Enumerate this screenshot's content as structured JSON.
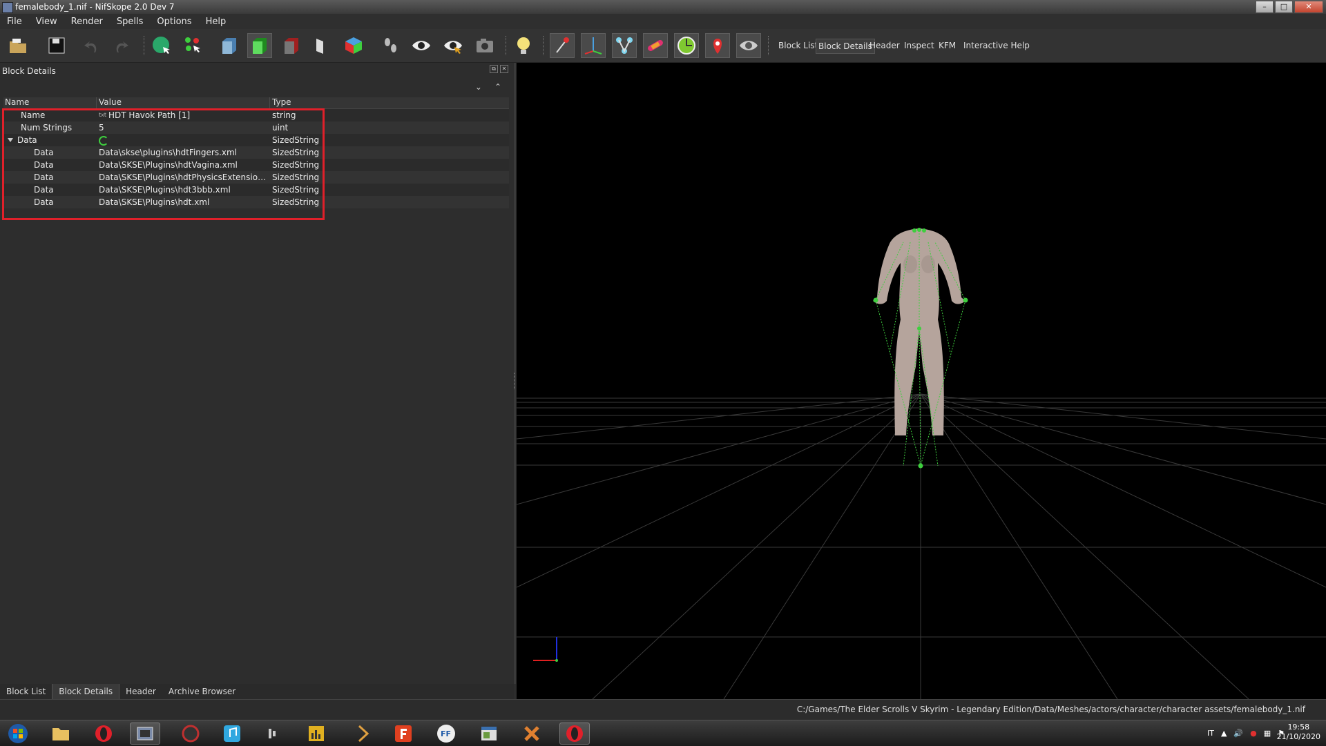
{
  "window": {
    "title": "femalebody_1.nif - NifSkope 2.0 Dev 7",
    "buttons": [
      "–",
      "□",
      "✕"
    ]
  },
  "menu": [
    "File",
    "View",
    "Render",
    "Spells",
    "Options",
    "Help"
  ],
  "toolbar": {
    "text_buttons": [
      "Block List",
      "Block Details",
      "Header",
      "Inspect",
      "KFM",
      "Interactive Help"
    ],
    "active_text_button": "Block Details"
  },
  "dock": {
    "title": "Block Details",
    "columns": {
      "name": "Name",
      "value": "Value",
      "type": "Type"
    },
    "rows": [
      {
        "name": "Name",
        "value": "HDT Havok Path [1]",
        "type": "string"
      },
      {
        "name": "Num Strings",
        "value": "5",
        "type": "uint"
      },
      {
        "name": "Data",
        "value": "",
        "type": "SizedString"
      },
      {
        "name": "Data",
        "value": "Data\\skse\\plugins\\hdtFingers.xml",
        "type": "SizedString"
      },
      {
        "name": "Data",
        "value": "Data\\SKSE\\Plugins\\hdtVagina.xml",
        "type": "SizedString"
      },
      {
        "name": "Data",
        "value": "Data\\SKSE\\Plugins\\hdtPhysicsExtensionsDef...",
        "type": "SizedString"
      },
      {
        "name": "Data",
        "value": "Data\\SKSE\\Plugins\\hdt3bbb.xml",
        "type": "SizedString"
      },
      {
        "name": "Data",
        "value": "Data\\SKSE\\Plugins\\hdt.xml",
        "type": "SizedString"
      }
    ],
    "string_icon": "txt"
  },
  "bottom_tabs": [
    "Block List",
    "Block Details",
    "Header",
    "Archive Browser"
  ],
  "active_bottom_tab": "Block Details",
  "status": {
    "path": "C:/Games/The Elder Scrolls V Skyrim - Legendary Edition/Data/Meshes/actors/character/character assets/femalebody_1.nif"
  },
  "tray": {
    "lang": "IT",
    "time": "19:58",
    "date": "21/10/2020"
  },
  "colors": {
    "accent_highlight": "#e0202a",
    "skeleton": "#3ecf3e",
    "viewport_bg": "#000000"
  }
}
